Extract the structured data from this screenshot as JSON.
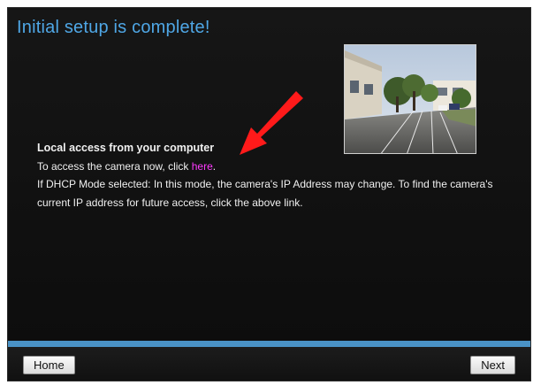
{
  "header": {
    "title": "Initial setup is complete!"
  },
  "local_access": {
    "heading": "Local access from your computer",
    "line1_before": "To access the camera now, click ",
    "line1_link": "here",
    "line1_after": ".",
    "dhcp_text": "If DHCP Mode selected: In this mode, the camera's IP Address may change. To find the camera's current IP address for future access, click the above link."
  },
  "footer": {
    "home_label": "Home",
    "next_label": "Next"
  },
  "colors": {
    "title": "#4fa7e6",
    "link": "#ff3bff",
    "divider": "#4a92c6",
    "arrow": "#ff1a1a"
  },
  "icons": {
    "annotation": "red-arrow-icon"
  }
}
